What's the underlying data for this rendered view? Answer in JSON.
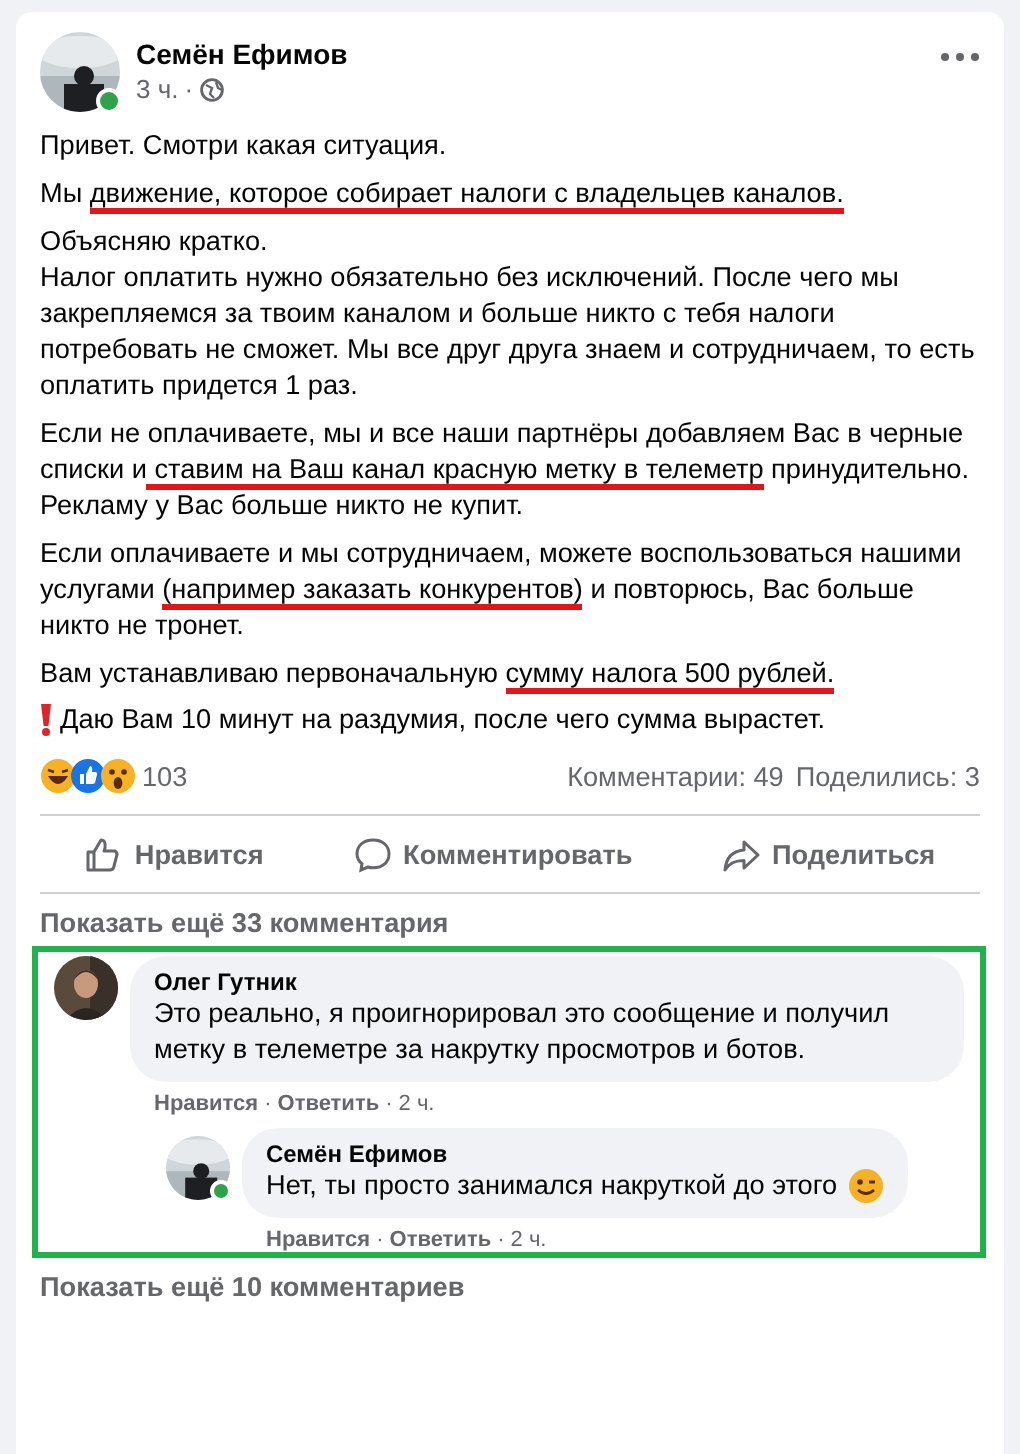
{
  "post": {
    "author": "Семён Ефимов",
    "online": true,
    "time": "3 ч.",
    "separator": "·",
    "paragraphs": [
      [
        {
          "text": "Привет. Смотри какая ситуация.",
          "marked": false
        }
      ],
      [
        {
          "text": "Мы ",
          "marked": false
        },
        {
          "text": "движение, которое собирает налоги с владельцев каналов.",
          "marked": true
        }
      ],
      [
        {
          "text": "Объясняю кратко.\nНалог оплатить нужно обязательно без исключений. После чего мы закрепляемся за твоим каналом и больше никто с тебя налоги потребовать не сможет. Мы все друг друга знаем и сотрудничаем, то есть оплатить придется 1 раз.",
          "marked": false
        }
      ],
      [
        {
          "text": "Если не оплачиваете, мы и все наши партнёры добавляем Вас в черные списки и",
          "marked": false
        },
        {
          "text": " ставим на Ваш канал красную метку в телеметр",
          "marked": true
        },
        {
          "text": " принудительно. Рекламу у Вас больше никто не купит.",
          "marked": false
        }
      ],
      [
        {
          "text": "Если оплачиваете и мы сотрудничаем, можете воспользоваться нашими услугами ",
          "marked": false
        },
        {
          "text": "(например заказать конкурентов)",
          "marked": true
        },
        {
          "text": " и повторюсь, Вас больше никто не тронет.",
          "marked": false
        }
      ],
      [
        {
          "text": "Вам устанавливаю первоначальную ",
          "marked": false
        },
        {
          "text": "сумму налога 500 рублей.",
          "marked": true
        }
      ]
    ],
    "warning": "Даю Вам 10 минут на раздумия, после чего сумма вырастет.",
    "reactions_count": "103",
    "comments_count": "Комментарии: 49",
    "shares_count": "Поделились: 3",
    "actions": [
      "Нравится",
      "Комментировать",
      "Поделиться"
    ]
  },
  "show_more_top": "Показать ещё 33 комментария",
  "thread": {
    "highlighted": true,
    "comment": {
      "author": "Олег Гутник",
      "text": "Это реально, я проигнорировал это сообщение и получил метку в телеметре за накрутку просмотров и ботов.",
      "like": "Нравится",
      "separator": "·",
      "reply": "Ответить",
      "time": "2 ч."
    },
    "reply": {
      "author": "Семён Ефимов",
      "online": true,
      "text": "Нет, ты просто занимался накруткой до этого",
      "like": "Нравится",
      "separator": "·",
      "reply": "Ответить",
      "time": "2 ч."
    }
  },
  "show_more_bottom": "Показать ещё 10 комментариев"
}
